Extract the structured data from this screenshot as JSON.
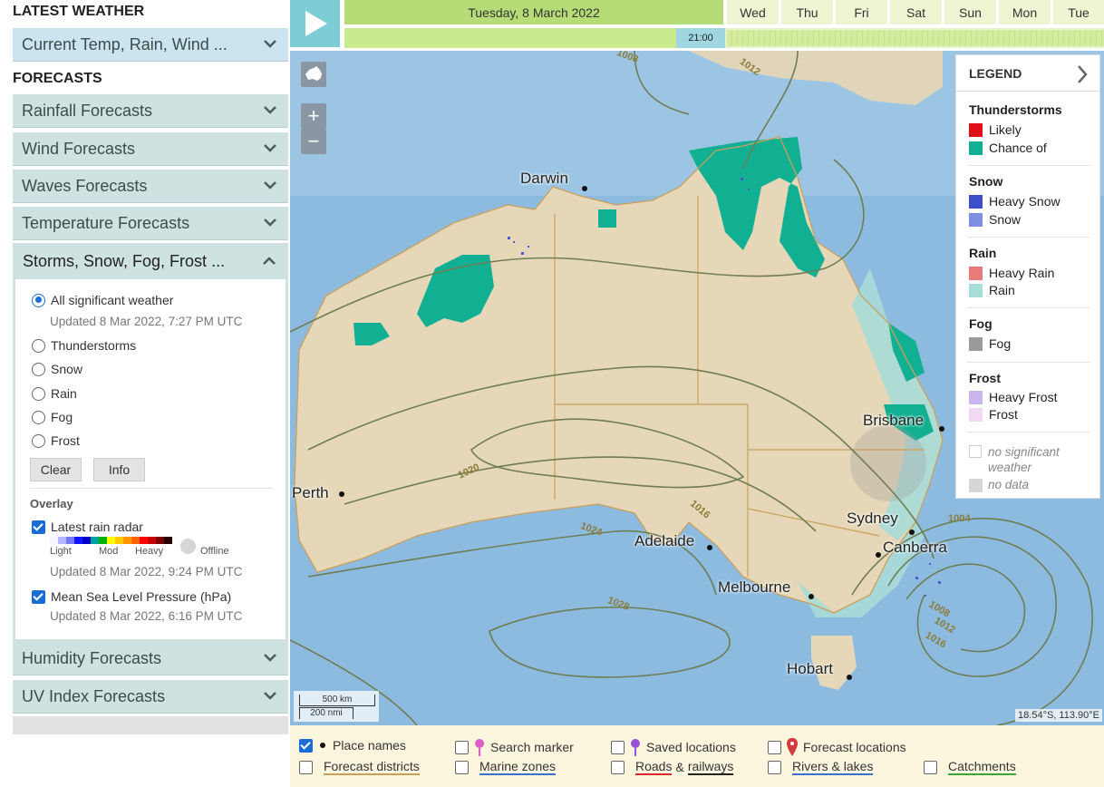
{
  "sidebar": {
    "latest_title": "LATEST WEATHER",
    "latest_item": "Current Temp, Rain, Wind ...",
    "forecasts_title": "FORECASTS",
    "forecast_items": [
      "Rainfall Forecasts",
      "Wind Forecasts",
      "Waves Forecasts",
      "Temperature Forecasts"
    ],
    "open_item": "Storms, Snow, Fog, Frost ...",
    "radios": [
      {
        "label": "All significant weather",
        "selected": true
      },
      {
        "label": "Thunderstorms",
        "selected": false
      },
      {
        "label": "Snow",
        "selected": false
      },
      {
        "label": "Rain",
        "selected": false
      },
      {
        "label": "Fog",
        "selected": false
      },
      {
        "label": "Frost",
        "selected": false
      }
    ],
    "updated_sig": "Updated 8 Mar 2022, 7:27 PM UTC",
    "clear_label": "Clear",
    "info_label": "Info",
    "overlay_title": "Overlay",
    "radar_label": "Latest rain radar",
    "radar_scale": {
      "light": "Light",
      "mod": "Mod",
      "heavy": "Heavy",
      "offline": "Offline"
    },
    "radar_colors": [
      "#f5f5ff",
      "#b4b4ff",
      "#7878ff",
      "#1414ff",
      "#0000c8",
      "#00a0a0",
      "#00b400",
      "#ffff00",
      "#ffc800",
      "#ff9600",
      "#ff6400",
      "#ff0000",
      "#c80000",
      "#780000",
      "#280000"
    ],
    "radar_updated": "Updated 8 Mar 2022, 9:24 PM UTC",
    "mslp_label": "Mean Sea Level Pressure (hPa)",
    "mslp_updated": "Updated 8 Mar 2022, 6:16 PM UTC",
    "after_items": [
      "Humidity Forecasts",
      "UV Index Forecasts"
    ]
  },
  "timebar": {
    "date": "Tuesday, 8 March 2022",
    "days": [
      "Wed",
      "Thu",
      "Fri",
      "Sat",
      "Sun",
      "Mon",
      "Tue"
    ],
    "time": "21:00"
  },
  "map": {
    "cities": [
      "Darwin",
      "Perth",
      "Adelaide",
      "Melbourne",
      "Hobart",
      "Brisbane",
      "Sydney",
      "Canberra"
    ],
    "isobars": [
      "1008",
      "1012",
      "1016",
      "1020",
      "1024",
      "1028",
      "1004",
      "1008",
      "1012",
      "1016"
    ],
    "scale_km": "500 km",
    "scale_nmi": "200 nmi",
    "coords": "18.54°S, 113.90°E"
  },
  "legend": {
    "title": "LEGEND",
    "groups": [
      {
        "name": "Thunderstorms",
        "items": [
          {
            "label": "Likely",
            "color": "#e0101a"
          },
          {
            "label": "Chance of",
            "color": "#12b092"
          }
        ]
      },
      {
        "name": "Snow",
        "items": [
          {
            "label": "Heavy Snow",
            "color": "#3c4fc8"
          },
          {
            "label": "Snow",
            "color": "#7f8ee4"
          }
        ]
      },
      {
        "name": "Rain",
        "items": [
          {
            "label": "Heavy Rain",
            "color": "#e87a7a"
          },
          {
            "label": "Rain",
            "color": "#a8dcd8"
          }
        ]
      },
      {
        "name": "Fog",
        "items": [
          {
            "label": "Fog",
            "color": "#9a9a9a"
          }
        ]
      },
      {
        "name": "Frost",
        "items": [
          {
            "label": "Heavy Frost",
            "color": "#c9b6ee"
          },
          {
            "label": "Frost",
            "color": "#f1d9f6"
          }
        ]
      }
    ],
    "no_sig": "no significant weather",
    "no_data": "no data"
  },
  "bottom": {
    "row1": [
      {
        "label": "Place names",
        "checked": true
      },
      {
        "label": "Search marker",
        "checked": false
      },
      {
        "label": "Saved locations",
        "checked": false
      },
      {
        "label": "Forecast locations",
        "checked": false
      }
    ],
    "row2": [
      {
        "label": "Forecast districts",
        "checked": false
      },
      {
        "label": "Marine zones",
        "checked": false
      },
      {
        "label": "Roads",
        "label2": "railways",
        "amp": "&",
        "checked": false
      },
      {
        "label": "Rivers & lakes",
        "checked": false
      },
      {
        "label": "Catchments",
        "checked": false
      }
    ]
  }
}
